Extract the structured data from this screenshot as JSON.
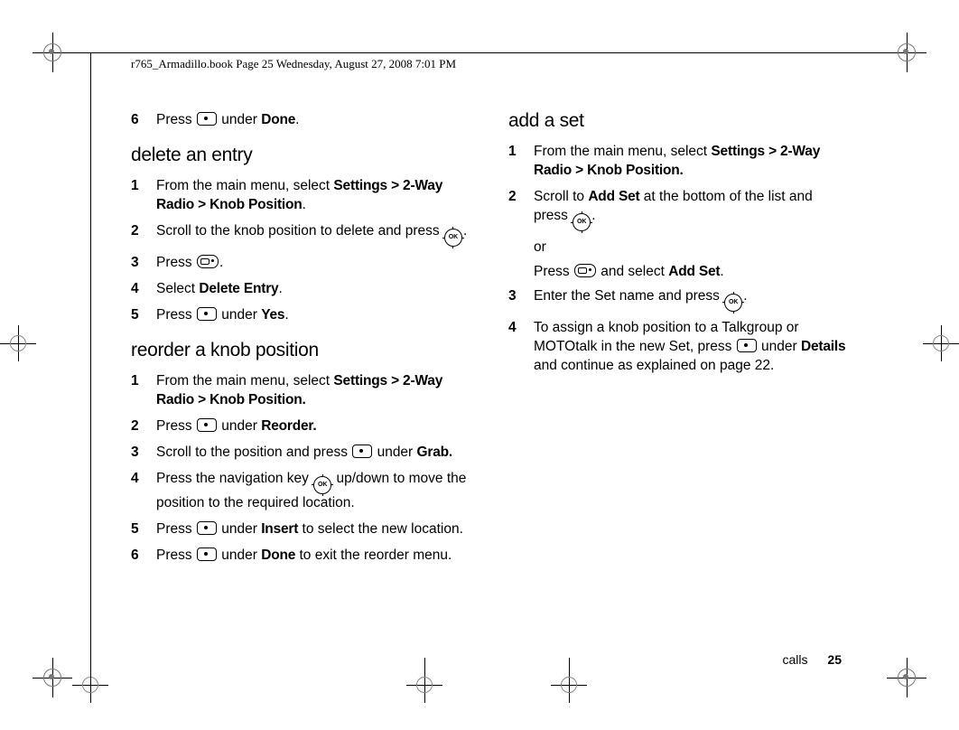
{
  "header": "r765_Armadillo.book  Page 25  Wednesday, August 27, 2008  7:01 PM",
  "footer": {
    "section": "calls",
    "page": "25"
  },
  "priorStep": {
    "num": "6",
    "pre": "Press ",
    "key": "key",
    "mid": " under ",
    "bold": "Done",
    "post": "."
  },
  "deleteEntry": {
    "heading": "delete an entry",
    "steps": [
      {
        "num": "1",
        "pre": "From the main menu, select ",
        "bold1": "Settings > 2-Way Radio > Knob Position",
        "post": "."
      },
      {
        "num": "2",
        "pre": "Scroll to the knob position to delete and press ",
        "icon": "ok",
        "post": "."
      },
      {
        "num": "3",
        "pre": "Press ",
        "icon": "menu",
        "post": "."
      },
      {
        "num": "4",
        "pre": "Select ",
        "bold1": "Delete Entry",
        "post": "."
      },
      {
        "num": "5",
        "pre": "Press ",
        "icon": "key",
        "mid": " under ",
        "bold1": "Yes",
        "post": "."
      }
    ]
  },
  "reorder": {
    "heading": "reorder a knob position",
    "steps": [
      {
        "num": "1",
        "pre": "From the main menu, select ",
        "bold1": "Settings > 2-Way Radio > Knob Position.",
        "post": ""
      },
      {
        "num": "2",
        "pre": "Press ",
        "icon": "key",
        "mid": " under ",
        "bold1": "Reorder.",
        "post": ""
      },
      {
        "num": "3",
        "pre": "Scroll to the position and press ",
        "icon": "key",
        "mid": " under ",
        "bold1": "Grab.",
        "post": ""
      },
      {
        "num": "4",
        "pre": "Press the navigation key ",
        "icon": "ok",
        "mid": " up/down to move the position to the required location.",
        "post": ""
      },
      {
        "num": "5",
        "pre": "Press ",
        "icon": "key",
        "mid": " under ",
        "bold1": "Insert",
        "post": " to select the new location."
      },
      {
        "num": "6",
        "pre": "Press ",
        "icon": "key",
        "mid": " under ",
        "bold1": "Done",
        "post": " to exit the reorder menu."
      }
    ]
  },
  "addSet": {
    "heading": "add a set",
    "step1": {
      "num": "1",
      "pre": "From the main menu, select ",
      "bold": "Settings > 2-Way Radio > Knob Position."
    },
    "step2": {
      "num": "2",
      "pre": "Scroll to ",
      "bold": "Add Set",
      "mid": " at the bottom of the list and press ",
      "icon": "ok",
      "post": ".",
      "or": "or",
      "altPre": "Press ",
      "altIcon": "menu",
      "altMid": " and select ",
      "altBold": "Add Set",
      "altPost": "."
    },
    "step3": {
      "num": "3",
      "pre": "Enter the Set name and press ",
      "icon": "ok",
      "post": "."
    },
    "step4": {
      "num": "4",
      "pre": "To assign a knob position to a Talkgroup or MOTOtalk in the new Set, press ",
      "icon": "key",
      "mid1": " under ",
      "bold": "Details",
      "mid2": " and continue as explained on page 22."
    }
  }
}
